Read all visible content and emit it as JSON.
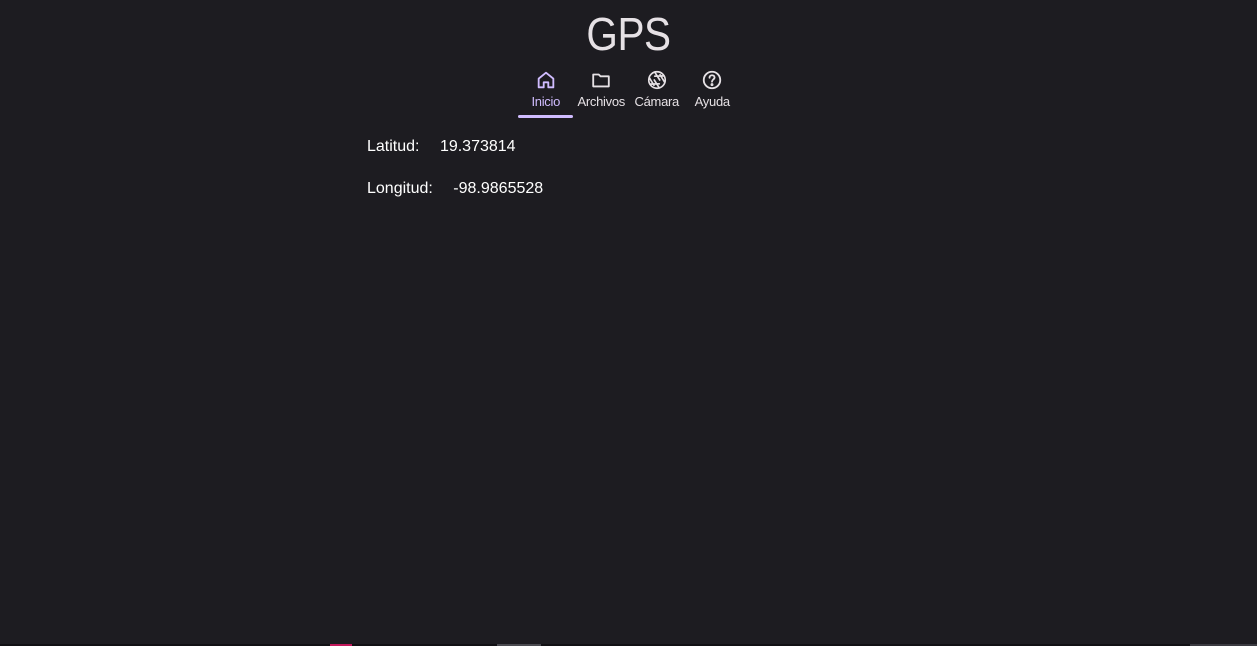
{
  "app": {
    "title": "GPS"
  },
  "tabs": [
    {
      "label": "Inicio",
      "icon": "home-icon",
      "active": true
    },
    {
      "label": "Archivos",
      "icon": "folder-icon",
      "active": false
    },
    {
      "label": "Cámara",
      "icon": "camera-shutter-icon",
      "active": false
    },
    {
      "label": "Ayuda",
      "icon": "help-icon",
      "active": false
    }
  ],
  "location": {
    "latitude_label": "Latitud:",
    "latitude_value": "19.373814",
    "longitude_label": "Longitud:",
    "longitude_value": "-98.9865528"
  },
  "colors": {
    "background": "#1d1c21",
    "accent": "#d0bcff",
    "text": "#e6e1e5"
  }
}
